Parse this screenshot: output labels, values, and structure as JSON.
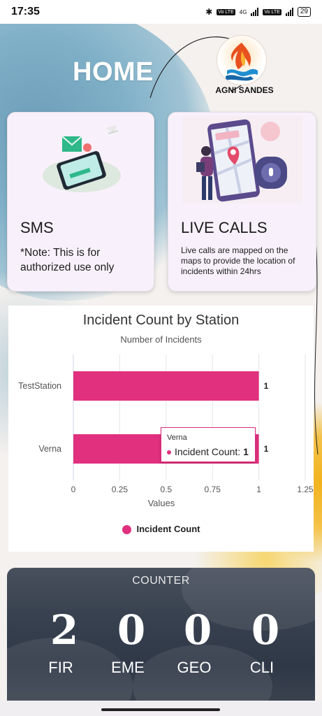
{
  "status_bar": {
    "time": "17:35",
    "battery": "29",
    "network_tag_1": "Vo LTE",
    "network_tag_2": "4G",
    "network_tag_3": "Vo LTE"
  },
  "header": {
    "title": "HOME",
    "logo_text": "AGNI SANDES"
  },
  "cards": {
    "sms": {
      "title": "SMS",
      "note": "*Note: This is for authorized use only"
    },
    "live_calls": {
      "title": "LIVE CALLS",
      "note": "Live calls are mapped on the maps to provide the location of incidents within 24hrs"
    }
  },
  "chart_data": {
    "type": "bar",
    "orientation": "horizontal",
    "title": "Incident Count by Station",
    "subtitle": "Number of Incidents",
    "xlabel": "Values",
    "ylabel": "",
    "categories": [
      "TestStation",
      "Verna"
    ],
    "series": [
      {
        "name": "Incident Count",
        "values": [
          1,
          1
        ],
        "color": "#e0307e"
      }
    ],
    "xlim": [
      0,
      1.25
    ],
    "xticks": [
      "0",
      "0.25",
      "0.5",
      "0.75",
      "1",
      "1.25"
    ],
    "data_labels": [
      "1",
      "1"
    ],
    "grid": true,
    "legend": "bottom",
    "tooltip": {
      "category": "Verna",
      "series": "Incident Count",
      "value": "1"
    }
  },
  "counter": {
    "title": "COUNTER",
    "items": [
      {
        "value": "2",
        "label": "FIR"
      },
      {
        "value": "0",
        "label": "EME"
      },
      {
        "value": "0",
        "label": "GEO"
      },
      {
        "value": "0",
        "label": "CLI"
      }
    ]
  },
  "colors": {
    "accent": "#e0307e",
    "card_bg": "#f8f1fb"
  }
}
